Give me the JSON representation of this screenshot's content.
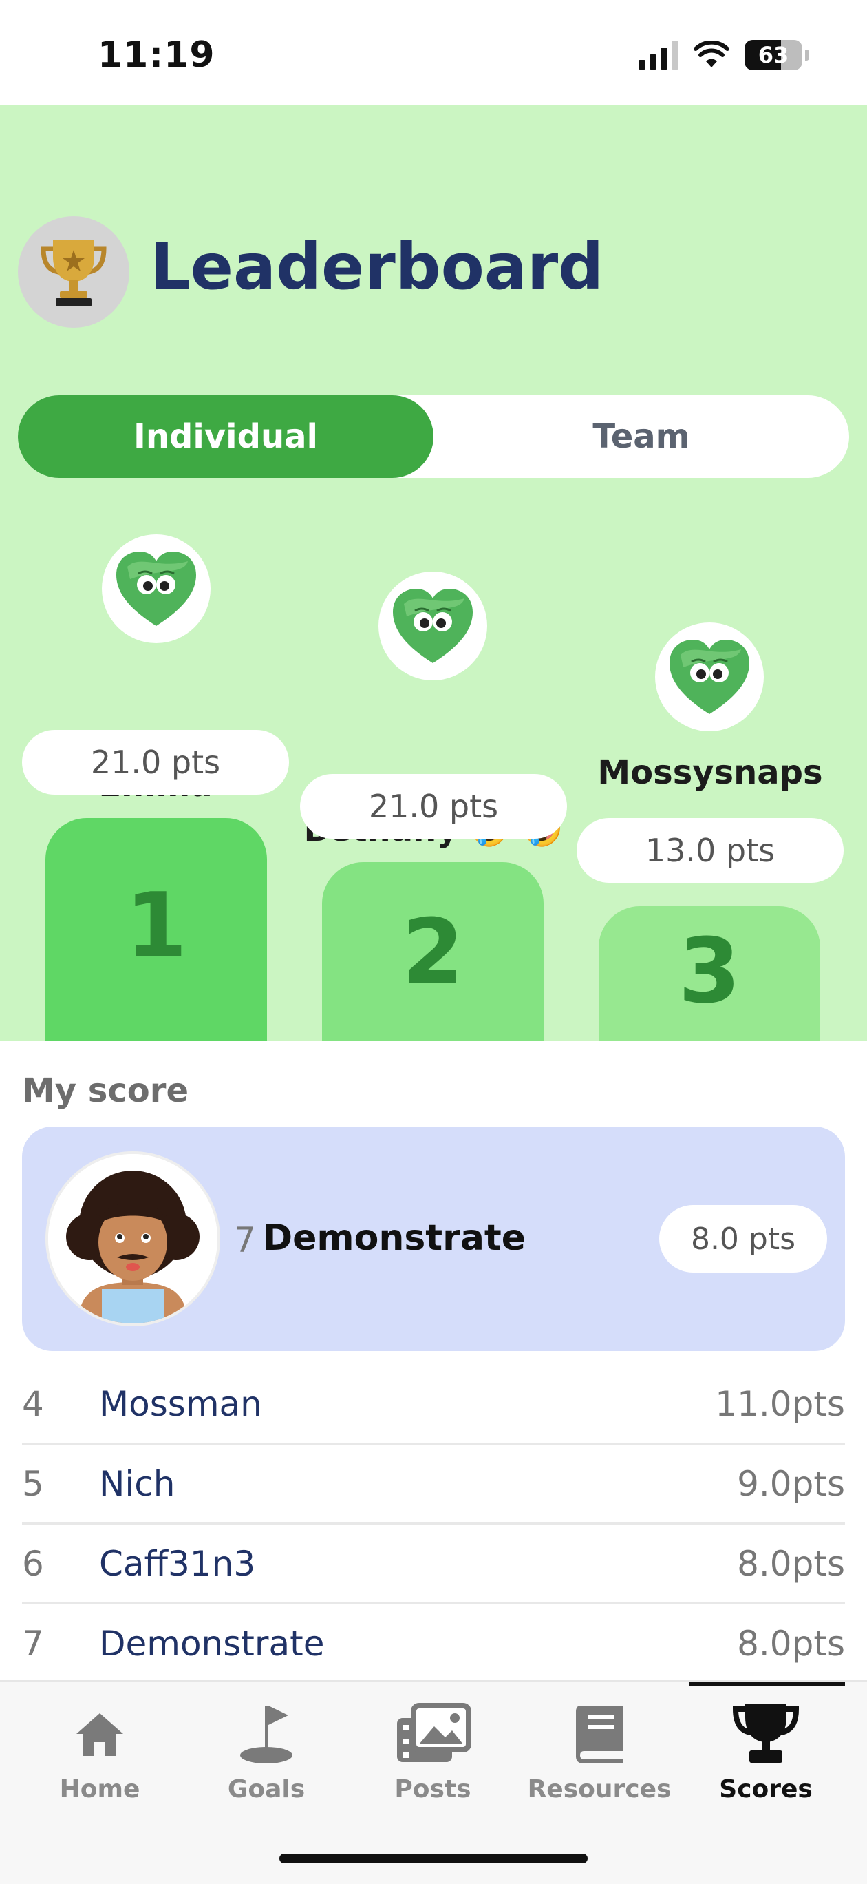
{
  "status": {
    "time": "11:19",
    "battery": "63"
  },
  "header": {
    "title": "Leaderboard",
    "icon": "trophy-icon"
  },
  "tabs": [
    {
      "label": "Individual",
      "active": true
    },
    {
      "label": "Team",
      "active": false
    }
  ],
  "podium": [
    {
      "rank": "1",
      "name": "Emma",
      "points": "21.0 pts"
    },
    {
      "rank": "2",
      "name": "Bethany 🤣 🤣",
      "points": "21.0 pts"
    },
    {
      "rank": "3",
      "name": "Mossysnaps",
      "points": "13.0 pts"
    }
  ],
  "my_score": {
    "label": "My score",
    "rank": "7",
    "name": "Demonstrate",
    "points": "8.0 pts"
  },
  "rankings": [
    {
      "rank": "4",
      "name": "Mossman",
      "points": "11.0pts"
    },
    {
      "rank": "5",
      "name": "Nich",
      "points": "9.0pts"
    },
    {
      "rank": "6",
      "name": "Caff31n3",
      "points": "8.0pts"
    },
    {
      "rank": "7",
      "name": "Demonstrate",
      "points": "8.0pts"
    }
  ],
  "nav": [
    {
      "label": "Home",
      "icon": "home-icon",
      "active": false
    },
    {
      "label": "Goals",
      "icon": "golf-flag-icon",
      "active": false
    },
    {
      "label": "Posts",
      "icon": "photos-icon",
      "active": false
    },
    {
      "label": "Resources",
      "icon": "book-icon",
      "active": false
    },
    {
      "label": "Scores",
      "icon": "trophy-icon",
      "active": true
    }
  ],
  "colors": {
    "header_bg": "#cbf5c2",
    "active_tab": "#3ea943",
    "title": "#203266",
    "my_card": "#d5ddfa",
    "podium_1": "#5fd765",
    "podium_2": "#84e382",
    "podium_3": "#97e890"
  }
}
